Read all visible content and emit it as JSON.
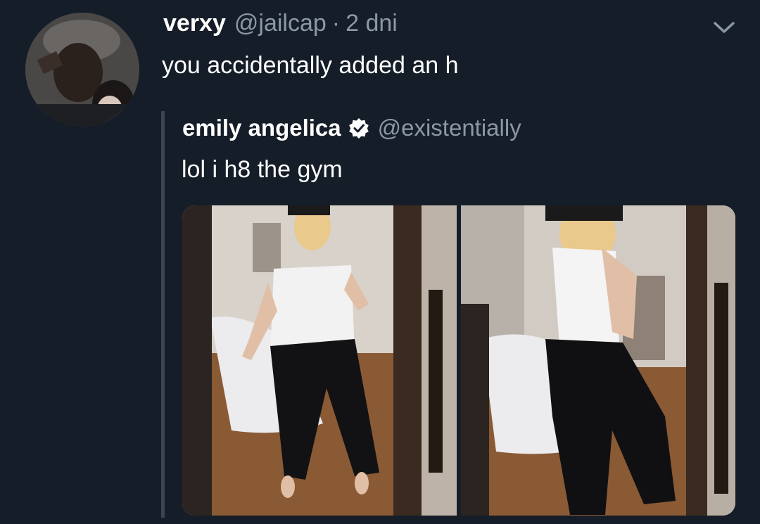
{
  "tweet": {
    "display_name": "verxy",
    "handle": "@jailcap",
    "separator": "·",
    "time": "2 dni",
    "text": "you accidentally added an h"
  },
  "quoted": {
    "display_name": "emily angelica",
    "handle": "@existentially",
    "text": "lol i h8 the gym",
    "verified_icon": "verified-badge-icon"
  },
  "icons": {
    "menu": "chevron-down-icon"
  },
  "colors": {
    "background": "#151d28",
    "secondary_text": "#8b98a5",
    "primary_text": "#ffffff"
  }
}
